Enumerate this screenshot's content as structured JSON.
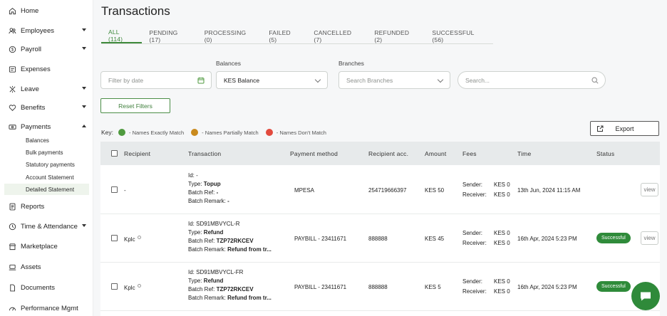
{
  "sidebar": {
    "items": [
      {
        "label": "Home",
        "icon": "home-icon"
      },
      {
        "label": "Employees",
        "icon": "users-icon"
      },
      {
        "label": "Payroll",
        "icon": "payroll-icon"
      },
      {
        "label": "Expenses",
        "icon": "receipt-icon"
      },
      {
        "label": "Leave",
        "icon": "leave-icon"
      },
      {
        "label": "Benefits",
        "icon": "heart-icon"
      },
      {
        "label": "Payments",
        "icon": "payments-icon"
      },
      {
        "label": "Reports",
        "icon": "report-icon"
      },
      {
        "label": "Time & Attendance",
        "icon": "clock-icon"
      },
      {
        "label": "Marketplace",
        "icon": "store-icon"
      },
      {
        "label": "Assets",
        "icon": "laptop-icon"
      },
      {
        "label": "Documents",
        "icon": "document-icon"
      },
      {
        "label": "Performance Mgmt",
        "icon": "performance-icon"
      }
    ],
    "payments_sub": [
      "Balances",
      "Bulk payments",
      "Statutory payments",
      "Account Statement",
      "Detailed Statement"
    ]
  },
  "page": {
    "title": "Transactions"
  },
  "tabs": [
    "ALL (114)",
    "PENDING (17)",
    "PROCESSING (0)",
    "FAILED (5)",
    "CANCELLED (7)",
    "REFUNDED (2)",
    "SUCCESSFUL (56)"
  ],
  "filters": {
    "date_placeholder": "Filter by date",
    "balances_label": "Balances",
    "balances_value": "KES Balance",
    "branches_label": "Branches",
    "branches_placeholder": "Search Branches",
    "search_placeholder": "Search...",
    "reset_label": "Reset Filters"
  },
  "key": {
    "title": "Key:",
    "items": [
      {
        "label": "- Names Exactly Match",
        "color": "#4f9a3f"
      },
      {
        "label": "- Names Partially Match",
        "color": "#c98a1d"
      },
      {
        "label": "- Names Don't Match",
        "color": "#e24a3e"
      }
    ]
  },
  "export_label": "Export",
  "table": {
    "headers": [
      "Recipient",
      "Transaction",
      "Payment method",
      "Recipient acc.",
      "Amount",
      "Fees",
      "Time",
      "Status"
    ],
    "rows": [
      {
        "recipient": "-",
        "tx": [
          "Id: -",
          "Type: Topup",
          "Batch Ref: -",
          "Batch Remark: -"
        ],
        "method": "MPESA",
        "account": "254719666397",
        "amount": "KES 50",
        "fees": {
          "sender_label": "Sender:",
          "sender": "KES 0",
          "receiver_label": "Receiver:",
          "receiver": "KES 0"
        },
        "time": "13th Jun, 2024 11:15 AM",
        "status": "",
        "action": "view"
      },
      {
        "recipient": "Kplc",
        "tx": [
          "Id: SD91MBVYCL-R",
          "Type: Refund",
          "Batch Ref: TZP72RKCEV",
          "Batch Remark: Refund from tr..."
        ],
        "method": "PAYBILL - 23411671",
        "account": "888888",
        "amount": "KES 45",
        "fees": {
          "sender_label": "Sender:",
          "sender": "KES 0",
          "receiver_label": "Receiver:",
          "receiver": "KES 0"
        },
        "time": "16th Apr, 2024 5:23 PM",
        "status": "Successful",
        "action": "view"
      },
      {
        "recipient": "Kplc",
        "tx": [
          "Id: SD91MBVYCL-FR",
          "Type: Refund",
          "Batch Ref: TZP72RKCEV",
          "Batch Remark: Refund from tr..."
        ],
        "method": "PAYBILL - 23411671",
        "account": "888888",
        "amount": "KES 5",
        "fees": {
          "sender_label": "Sender:",
          "sender": "KES 0",
          "receiver_label": "Receiver:",
          "receiver": "KES 0"
        },
        "time": "16th Apr, 2024 5:23 PM",
        "status": "Successful",
        "action": ""
      }
    ]
  },
  "colors": {
    "accent": "#3f8a3c",
    "success": "#2f8b3a"
  }
}
